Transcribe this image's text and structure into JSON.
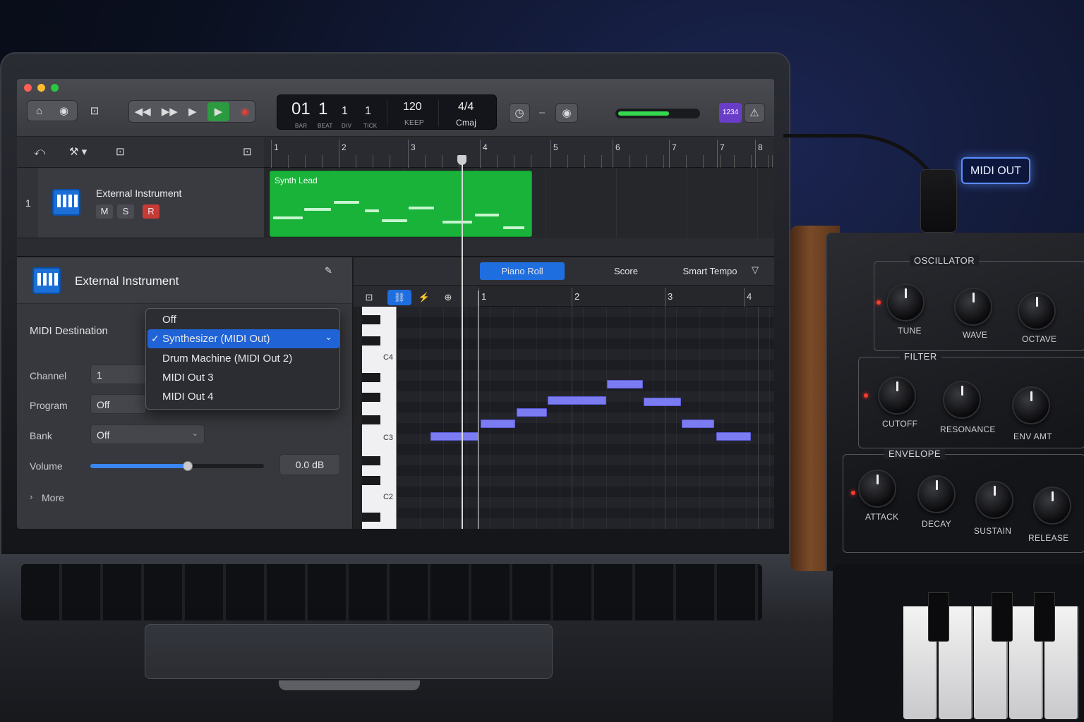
{
  "transport": {
    "bar": "01",
    "beat": "1",
    "div": "1",
    "tick": "1",
    "bar_label": "BAR",
    "beat_label": "BEAT",
    "div_label": "DIV",
    "tick_label": "TICK",
    "tempo": "120",
    "tempo_label": "KEEP",
    "time_signature": "4/4",
    "key": "Cmaj",
    "count_in": "1234"
  },
  "tracks": {
    "ruler": [
      "1",
      "2",
      "3",
      "4",
      "5",
      "6",
      "7",
      "7",
      "8"
    ],
    "rows": [
      {
        "number": "1",
        "name": "External Instrument",
        "mute": "M",
        "solo": "S",
        "record": "R",
        "region_name": "Synth Lead"
      }
    ]
  },
  "inspector": {
    "title": "External Instrument",
    "midi_destination_label": "MIDI Destination",
    "channel_label": "Channel",
    "channel_value": "1",
    "program_label": "Program",
    "program_value": "Off",
    "bank_label": "Bank",
    "bank_value": "Off",
    "volume_label": "Volume",
    "volume_value": "0.0 dB",
    "volume_fraction": 0.56,
    "more_label": "More"
  },
  "midi_destination_menu": {
    "options": [
      "Off",
      "Synthesizer (MIDI Out)",
      "Drum Machine (MIDI Out 2)",
      "MIDI Out 3",
      "MIDI Out 4"
    ],
    "selected": "Synthesizer (MIDI Out)",
    "checkmark": "✓"
  },
  "editor": {
    "tabs": [
      "Piano Roll",
      "Score",
      "Smart Tempo"
    ],
    "active_tab": "Piano Roll",
    "ruler": [
      "1",
      "2",
      "3",
      "4"
    ],
    "key_labels": [
      "C4",
      "C3",
      "C2"
    ]
  },
  "hardware": {
    "midi_out_label": "MIDI OUT",
    "sections": [
      {
        "title": "OSCILLATOR",
        "knobs": [
          "TUNE",
          "WAVE",
          "OCTAVE"
        ]
      },
      {
        "title": "FILTER",
        "knobs": [
          "CUTOFF",
          "RESONANCE",
          "ENV AMT"
        ]
      },
      {
        "title": "ENVELOPE",
        "knobs": [
          "ATTACK",
          "DECAY",
          "SUSTAIN",
          "RELEASE"
        ]
      }
    ]
  },
  "icons": {
    "toolbar": [
      "library-icon",
      "inspector-icon",
      "mixer-icon",
      "rewind-icon",
      "fast-forward-icon",
      "play-icon",
      "go-to-start-icon",
      "record-icon",
      "metronome-icon",
      "tuner-icon",
      "warning-icon"
    ],
    "editor_tools": [
      "pointer-tool-icon",
      "link-icon",
      "snap-icon",
      "zoom-icon"
    ]
  },
  "colors": {
    "region": "#19b33a",
    "piano_roll_note": "#7c7cf2",
    "accent": "#1f6ee0",
    "record": "#e0413a"
  }
}
